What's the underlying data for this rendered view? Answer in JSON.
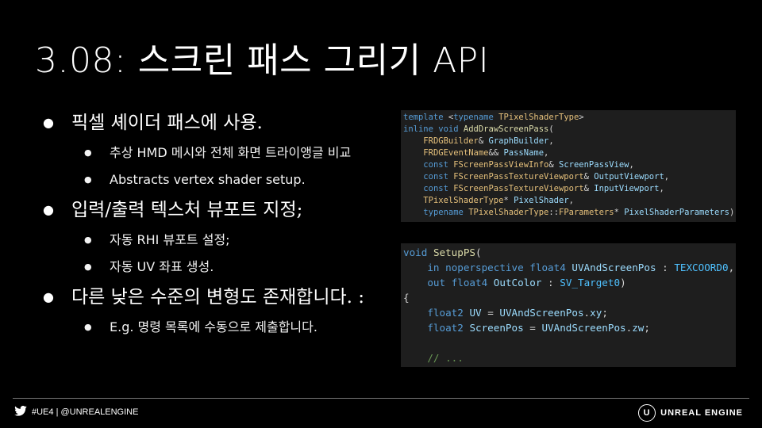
{
  "slide": {
    "title": "3.08: 스크린 패스 그리기 API",
    "bullets": [
      {
        "level": 1,
        "text": "픽셀 셰이더 패스에 사용."
      },
      {
        "level": 2,
        "text": "추상 HMD 메시와 전체 화면 트라이앵글 비교"
      },
      {
        "level": 2,
        "text": "Abstracts vertex shader setup."
      },
      {
        "level": 1,
        "text": "입력/출력 텍스처 뷰포트 지정;"
      },
      {
        "level": 2,
        "text": "자동 RHI 뷰포트 설정;"
      },
      {
        "level": 2,
        "text": "자동 UV 좌표 생성."
      },
      {
        "level": 1,
        "text": "다른 낮은 수준의 변형도 존재합니다. :"
      },
      {
        "level": 2,
        "text": "E.g. 명령 목록에 수동으로 제출합니다."
      }
    ]
  },
  "code_block_1": {
    "lines": [
      "template <typename TPixelShaderType>",
      "inline void AddDrawScreenPass(",
      "    FRDGBuilder& GraphBuilder,",
      "    FRDGEventName&& PassName,",
      "    const FScreenPassViewInfo& ScreenPassView,",
      "    const FScreenPassTextureViewport& OutputViewport,",
      "    const FScreenPassTextureViewport& InputViewport,",
      "    TPixelShaderType* PixelShader,",
      "    typename TPixelShaderType::FParameters* PixelShaderParameters)"
    ]
  },
  "code_block_2": {
    "lines": [
      "void SetupPS(",
      "    in noperspective float4 UVAndScreenPos : TEXCOORD0,",
      "    out float4 OutColor : SV_Target0)",
      "{",
      "    float2 UV = UVAndScreenPos.xy;",
      "    float2 ScreenPos = UVAndScreenPos.zw;",
      "",
      "    // ..."
    ]
  },
  "footer": {
    "social": "#UE4 | @UNREALENGINE",
    "brand": "UNREAL ENGINE",
    "logo_letter": "U",
    "social_icon": "twitter-bird-icon"
  }
}
